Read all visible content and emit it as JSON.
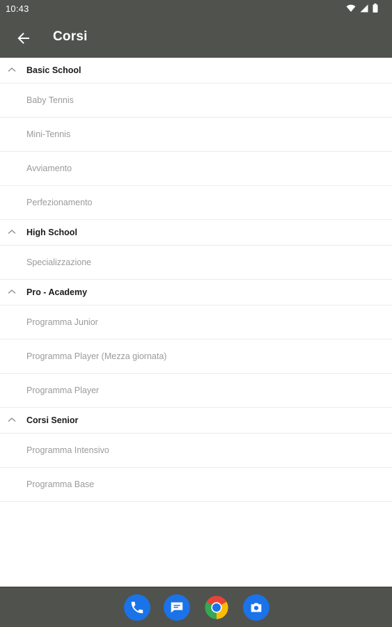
{
  "status_bar": {
    "time": "10:43",
    "icons": [
      "wifi-icon",
      "cellular-signal-icon",
      "battery-icon"
    ]
  },
  "app_bar": {
    "title": "Corsi",
    "back_icon": "arrow-back-icon",
    "background": "#50524e"
  },
  "groups": [
    {
      "title": "Basic School",
      "items": [
        "Baby Tennis",
        "Mini-Tennis",
        "Avviamento",
        "Perfezionamento"
      ]
    },
    {
      "title": "High School",
      "items": [
        "Specializzazione"
      ]
    },
    {
      "title": "Pro - Academy",
      "items": [
        "Programma Junior",
        "Programma Player (Mezza giornata)",
        "Programma Player"
      ]
    },
    {
      "title": "Corsi Senior",
      "items": [
        "Programma Intensivo",
        "Programma Base"
      ]
    }
  ],
  "dock": {
    "apps": [
      "phone-app-icon",
      "messages-app-icon",
      "chrome-app-icon",
      "camera-app-icon"
    ],
    "accent": "#1a73e8"
  }
}
